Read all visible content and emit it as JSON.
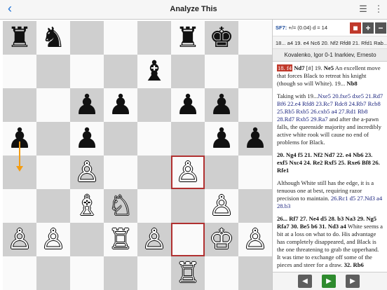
{
  "app": {
    "title": "Analyze This"
  },
  "engine": {
    "name": "SF7:",
    "eval": "+/= (0.04) d = 14",
    "pv": "18... a4 19. e4 Nc6 20. Nf2 Rfd8 21. Rfd1 Rab...",
    "buttons": {
      "stop": "■",
      "plus": "+",
      "minus": "−"
    },
    "colors": {
      "stop": "#c0392b",
      "btn": "#555555"
    }
  },
  "game": {
    "players": "Kovalenko, Igor 0-1 Inarkiev, Ernesto"
  },
  "notes": {
    "p1": {
      "cur": "18. f4",
      "a": "Nd7",
      "b": " [#] 19. ",
      "c": "Ne5",
      "d": " An excellent move that forces Black to retreat his knight (though so will White). 19... ",
      "e": "Nb8"
    },
    "p2": {
      "a": "Taking with 19...",
      "b": "Nxe5 20.fxe5 dxe5 21.Rd7 Bf6 22.e4 Rfd8 23.Rc7 Rdc8 24.Rb7 Rcb8 25.Rb5 Rxb5 26.cxb5 a4 27.Rd1 Rb8 28.Rd7 Rxb5 29.Ra7",
      "c": " and after the a-pawn falls, the queenside majority and incredibly active white rook will cause no end of problems for Black."
    },
    "p3": "20. Ng4 f5 21. Nf2 Nd7 22. e4 Nb6 23. exf5 Nxc4 24. Re2 Rxf5 25. Rxe6 Bf8 26. Rfe1",
    "p4": {
      "a": "Although White still has the edge, it is a tenuous one at best, requiring razor precision to maintain. ",
      "b": "26.Rc1 d5 27.Nd3 a4 28.b3"
    },
    "p5": {
      "a": "26... Rf7 27. Ne4 d5 28. b3 Na3 29. Ng5 Rfa7 30. Be5 b6 31. Nd3 a4",
      "b": " White seems a bit at a loss on what to do. His advantage has completely disappeared, and Black is the one threatening to grab the upperhand. It was time to exchange off some of the pieces and steer for a draw. ",
      "c": "32. Rb6"
    }
  },
  "nav": {
    "prev": "◀",
    "play": "▶",
    "next": "▶",
    "colors": {
      "nav": "#5e5e5e",
      "play": "#2e8b2e"
    }
  },
  "board": {
    "pieces": [
      {
        "sq": "a8",
        "glyph": "♜",
        "side": "b",
        "name": "black-rook"
      },
      {
        "sq": "b8",
        "glyph": "♞",
        "side": "b",
        "name": "black-knight"
      },
      {
        "sq": "f8",
        "glyph": "♜",
        "side": "b",
        "name": "black-rook"
      },
      {
        "sq": "g8",
        "glyph": "♚",
        "side": "b",
        "name": "black-king"
      },
      {
        "sq": "e7",
        "glyph": "♝",
        "side": "b",
        "name": "black-bishop"
      },
      {
        "sq": "c6",
        "glyph": "♟",
        "side": "b",
        "name": "black-pawn"
      },
      {
        "sq": "d6",
        "glyph": "♟",
        "side": "b",
        "name": "black-pawn"
      },
      {
        "sq": "f6",
        "glyph": "♟",
        "side": "b",
        "name": "black-pawn"
      },
      {
        "sq": "g6",
        "glyph": "♟",
        "side": "b",
        "name": "black-pawn"
      },
      {
        "sq": "a5",
        "glyph": "♟",
        "side": "b",
        "name": "black-pawn"
      },
      {
        "sq": "c5",
        "glyph": "♟",
        "side": "b",
        "name": "black-pawn"
      },
      {
        "sq": "g5",
        "glyph": "♟",
        "side": "b",
        "name": "black-pawn"
      },
      {
        "sq": "h5",
        "glyph": "♟",
        "side": "b",
        "name": "black-pawn"
      },
      {
        "sq": "c4",
        "glyph": "♙",
        "side": "w",
        "name": "white-pawn"
      },
      {
        "sq": "f4",
        "glyph": "♙",
        "side": "w",
        "name": "white-pawn"
      },
      {
        "sq": "c3",
        "glyph": "♗",
        "side": "w",
        "name": "white-bishop"
      },
      {
        "sq": "d3",
        "glyph": "♘",
        "side": "w",
        "name": "white-knight"
      },
      {
        "sq": "g3",
        "glyph": "♙",
        "side": "w",
        "name": "white-pawn"
      },
      {
        "sq": "a2",
        "glyph": "♙",
        "side": "w",
        "name": "white-pawn"
      },
      {
        "sq": "b2",
        "glyph": "♙",
        "side": "w",
        "name": "white-pawn"
      },
      {
        "sq": "d2",
        "glyph": "♖",
        "side": "w",
        "name": "white-rook"
      },
      {
        "sq": "e2",
        "glyph": "♙",
        "side": "w",
        "name": "white-pawn"
      },
      {
        "sq": "g2",
        "glyph": "♔",
        "side": "w",
        "name": "white-king"
      },
      {
        "sq": "h2",
        "glyph": "♙",
        "side": "w",
        "name": "white-pawn"
      },
      {
        "sq": "f1",
        "glyph": "♖",
        "side": "w",
        "name": "white-rook"
      }
    ],
    "highlight": [
      "f2",
      "f4"
    ],
    "arrow": {
      "from": "a5",
      "to": "a4",
      "color": "#f39c12"
    }
  }
}
